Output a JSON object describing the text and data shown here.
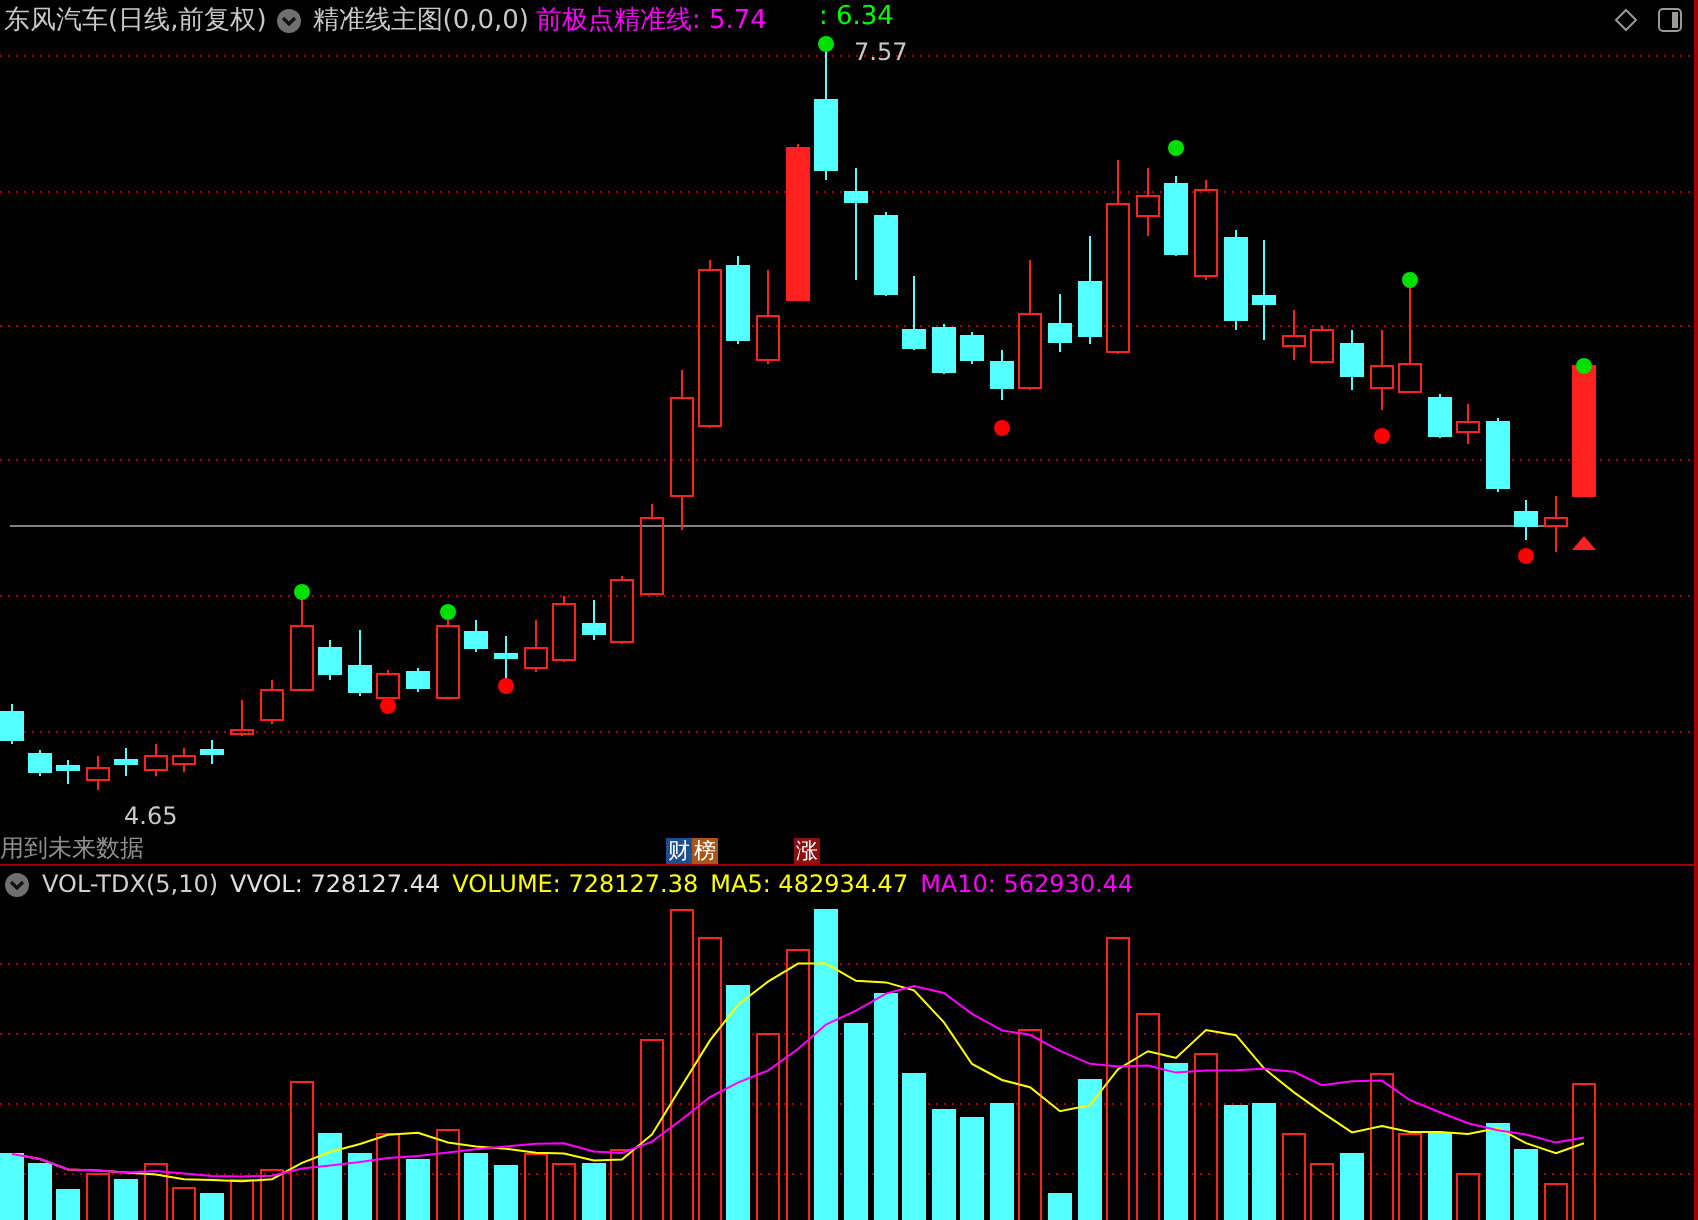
{
  "header": {
    "title": "东风汽车(日线,前复权)",
    "indicator": "精准线主图(0,0,0)",
    "values": [
      {
        "text": "前极点精准线: 5.74",
        "color": "#ff00ff"
      },
      {
        "text": ": 6.34",
        "color": "#00ff00"
      }
    ]
  },
  "price_panel": {
    "high_label": "7.57",
    "low_label": "4.65",
    "note": "用到未来数据"
  },
  "badges": [
    {
      "text": "财",
      "color": "#1c4f8f"
    },
    {
      "text": "榜",
      "color": "#a8561a"
    },
    {
      "text": "涨",
      "color": "#8c1010"
    }
  ],
  "volume_panel": {
    "name": "VOL-TDX(5,10)",
    "values": [
      {
        "text": "VVOL: 728127.44",
        "color": "#e0e0e0"
      },
      {
        "text": "VOLUME: 728127.38",
        "color": "#ffff00"
      },
      {
        "text": "MA5: 482934.47",
        "color": "#ffff00"
      },
      {
        "text": "MA10: 562930.44",
        "color": "#ff00ff"
      }
    ]
  }
}
